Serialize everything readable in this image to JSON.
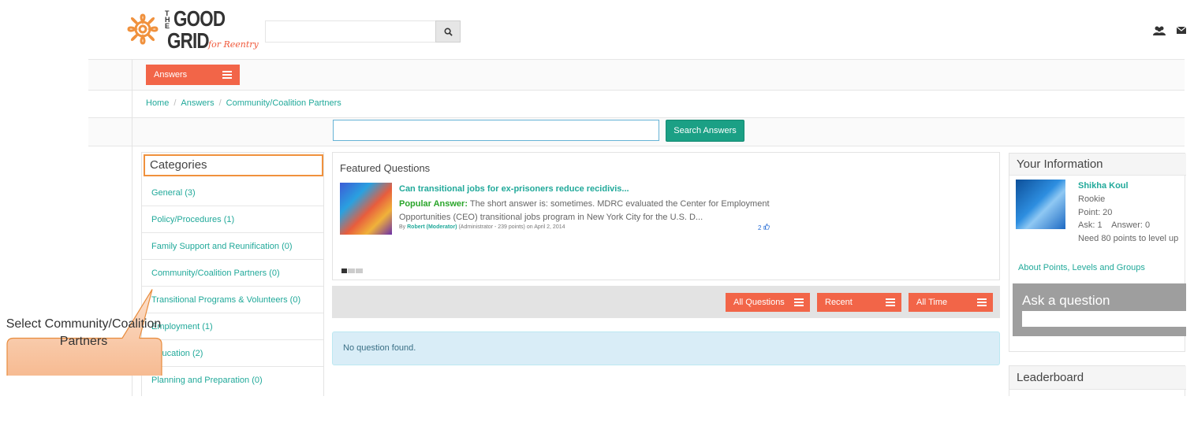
{
  "logo": {
    "the": "THE",
    "good": "GOOD",
    "grid": "GRID",
    "tagline": "for Reentry"
  },
  "header": {
    "search_placeholder": "",
    "icons": [
      "search-icon",
      "users-icon",
      "envelope-icon"
    ]
  },
  "nav": {
    "answers_label": "Answers"
  },
  "breadcrumb": {
    "items": [
      "Home",
      "Answers",
      "Community/Coalition Partners"
    ],
    "separator": "/"
  },
  "answer_search": {
    "placeholder": "",
    "button_label": "Search Answers"
  },
  "categories": {
    "title": "Categories",
    "items": [
      "General (3)",
      "Policy/Procedures (1)",
      "Family Support and Reunification (0)",
      "Community/Coalition Partners (0)",
      "Transitional Programs & Volunteers (0)",
      "Employment (1)",
      "Education (2)",
      "Planning and Preparation (0)"
    ]
  },
  "featured": {
    "title": "Featured Questions",
    "question": "Can transitional jobs for ex-prisoners reduce recidivis...",
    "popular_label": "Popular Answer:",
    "answer_text": "The short answer is: sometimes. MDRC evaluated the Center for Employment Opportunities (CEO) transitional jobs program in New York City for the U.S. D...",
    "by_label": "By",
    "author": "Robert (Moderator)",
    "author_meta": "(Administrator - 239 points)",
    "date": "on April 2, 2014",
    "likes": "2"
  },
  "filters": {
    "all_questions": "All Questions",
    "recent": "Recent",
    "all_time": "All Time"
  },
  "no_question": "No question found.",
  "your_info": {
    "title": "Your Information",
    "name": "Shikha Koul",
    "rank": "Rookie",
    "points": "Point: 20",
    "ask_answer": "Ask: 1    Answer: 0",
    "need": "Need 80 points to level up",
    "link": "About Points, Levels and Groups"
  },
  "ask": {
    "label": "Ask a question",
    "placeholder": ""
  },
  "leaderboard": {
    "title": "Leaderboard"
  },
  "callout": {
    "text": "Select Community/Coalition Partners"
  },
  "colors": {
    "accent": "#f26548",
    "link": "#21a99a",
    "search_button": "#1ba085",
    "callout": "#f5b183"
  }
}
